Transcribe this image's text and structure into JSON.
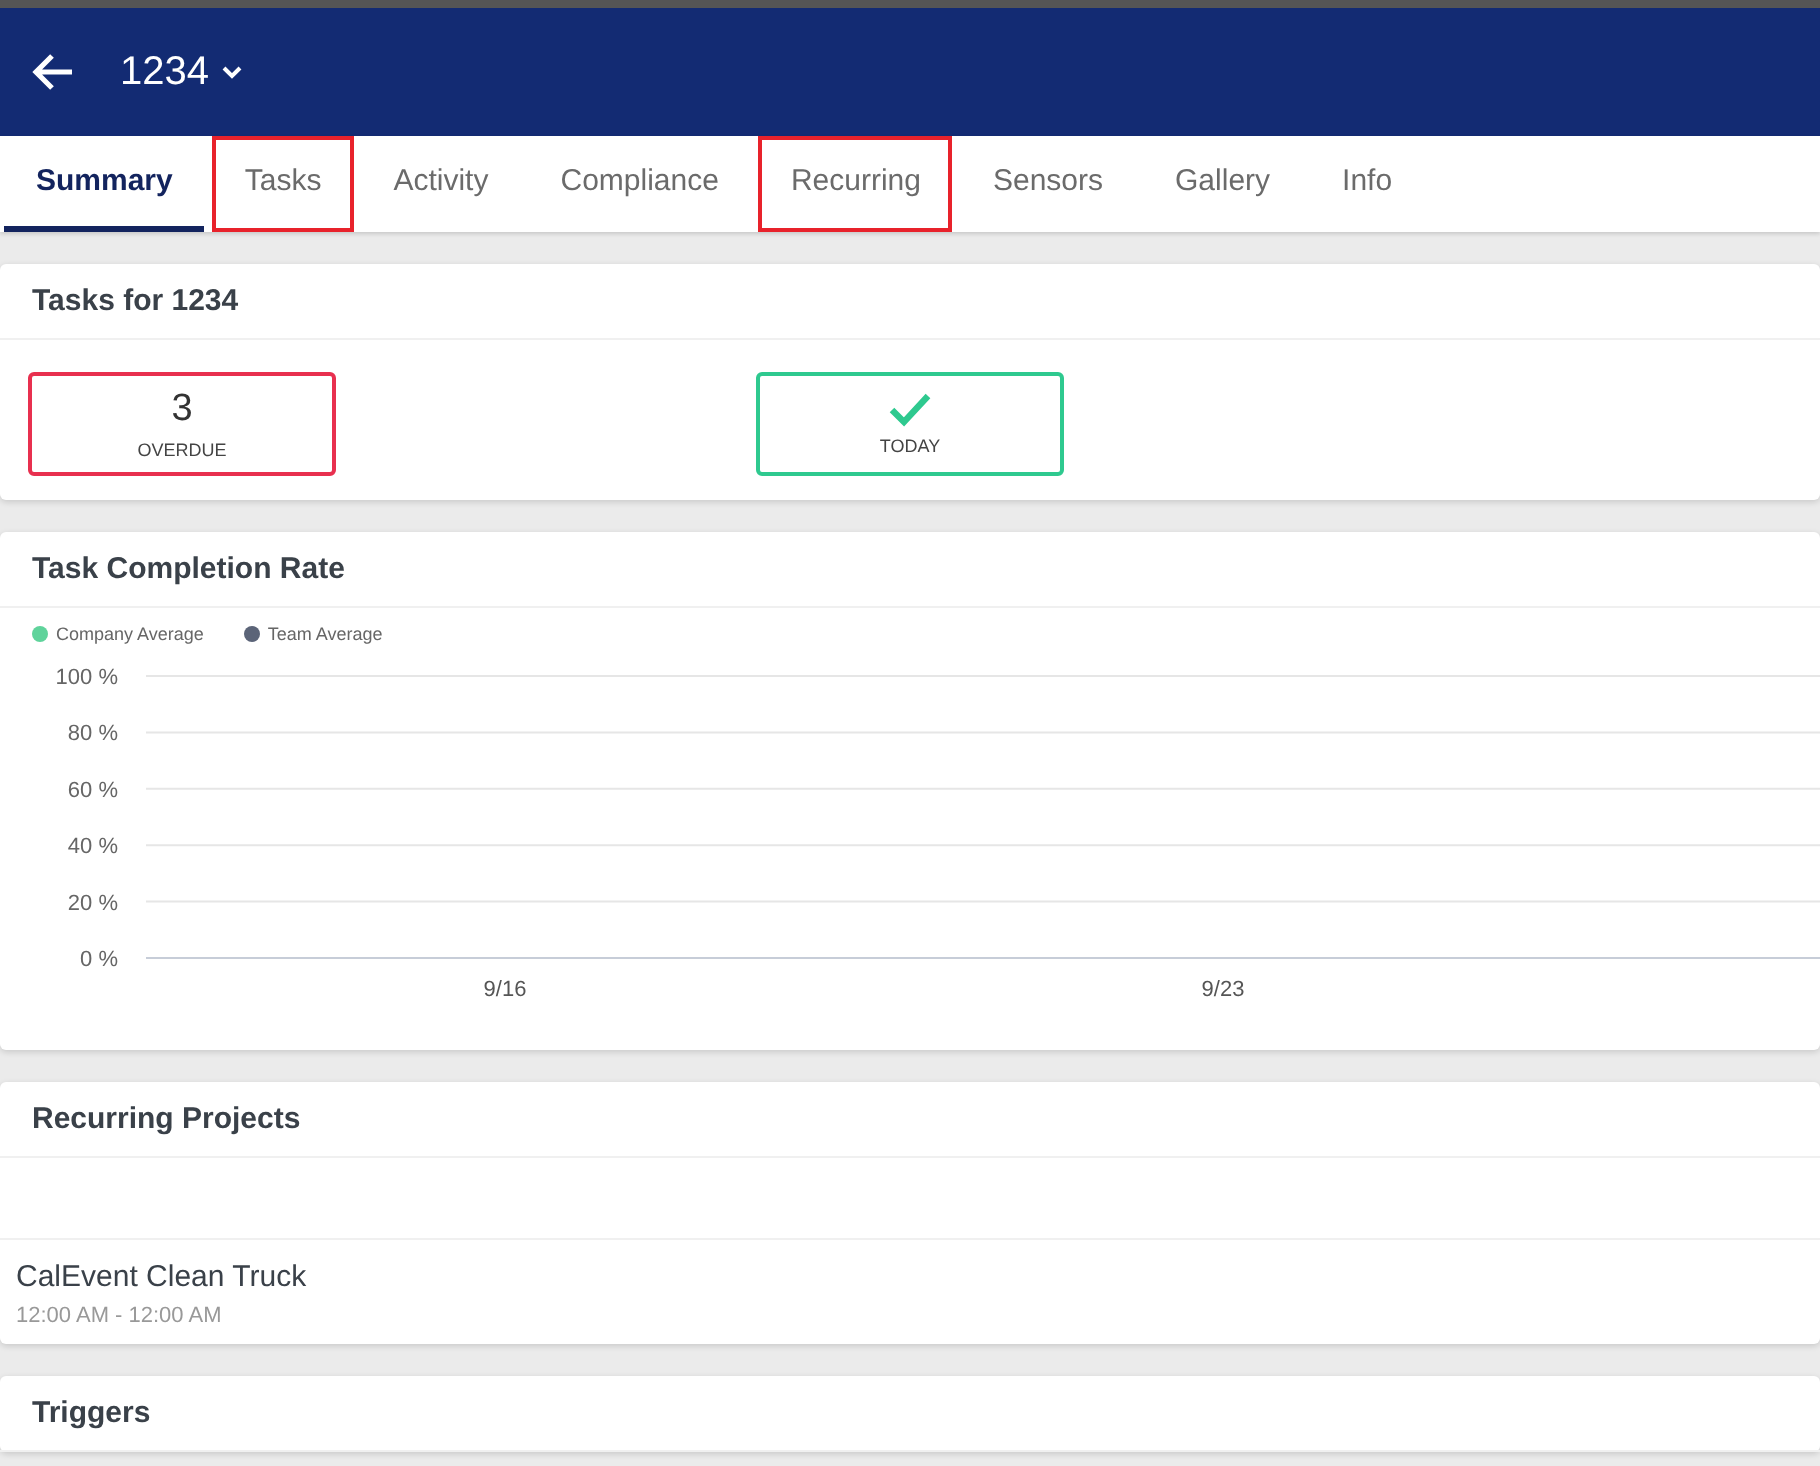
{
  "header": {
    "title": "1234"
  },
  "tabs": [
    {
      "label": "Summary",
      "selected": true,
      "highlighted": false
    },
    {
      "label": "Tasks",
      "selected": false,
      "highlighted": true
    },
    {
      "label": "Activity",
      "selected": false,
      "highlighted": false
    },
    {
      "label": "Compliance",
      "selected": false,
      "highlighted": false
    },
    {
      "label": "Recurring",
      "selected": false,
      "highlighted": true
    },
    {
      "label": "Sensors",
      "selected": false,
      "highlighted": false
    },
    {
      "label": "Gallery",
      "selected": false,
      "highlighted": false
    },
    {
      "label": "Info",
      "selected": false,
      "highlighted": false
    }
  ],
  "tasks_card": {
    "title": "Tasks for 1234",
    "tiles": [
      {
        "kind": "count",
        "value": "3",
        "label": "OVERDUE",
        "color": "#e8304f"
      },
      {
        "kind": "check",
        "label": "TODAY",
        "color": "#2ec98f"
      }
    ]
  },
  "completion_card": {
    "title": "Task Completion Rate",
    "chart_data": {
      "type": "line",
      "grid": true,
      "categories": [
        "9/16",
        "9/23"
      ],
      "ylim": [
        0,
        100
      ],
      "yticks": [
        {
          "value": 0,
          "label": "0 %"
        },
        {
          "value": 20,
          "label": "20 %"
        },
        {
          "value": 40,
          "label": "40 %"
        },
        {
          "value": 60,
          "label": "60 %"
        },
        {
          "value": 80,
          "label": "80 %"
        },
        {
          "value": 100,
          "label": "100 %"
        }
      ],
      "series": [
        {
          "name": "Company Average",
          "color": "#5fd39b",
          "values": [
            null,
            null
          ]
        },
        {
          "name": "Team Average",
          "color": "#5b6478",
          "values": [
            null,
            null
          ]
        }
      ]
    }
  },
  "recurring_card": {
    "title": "Recurring Projects",
    "items": [
      {
        "name": "CalEvent Clean Truck",
        "time": "12:00 AM - 12:00 AM"
      }
    ]
  },
  "triggers_card": {
    "title": "Triggers"
  }
}
